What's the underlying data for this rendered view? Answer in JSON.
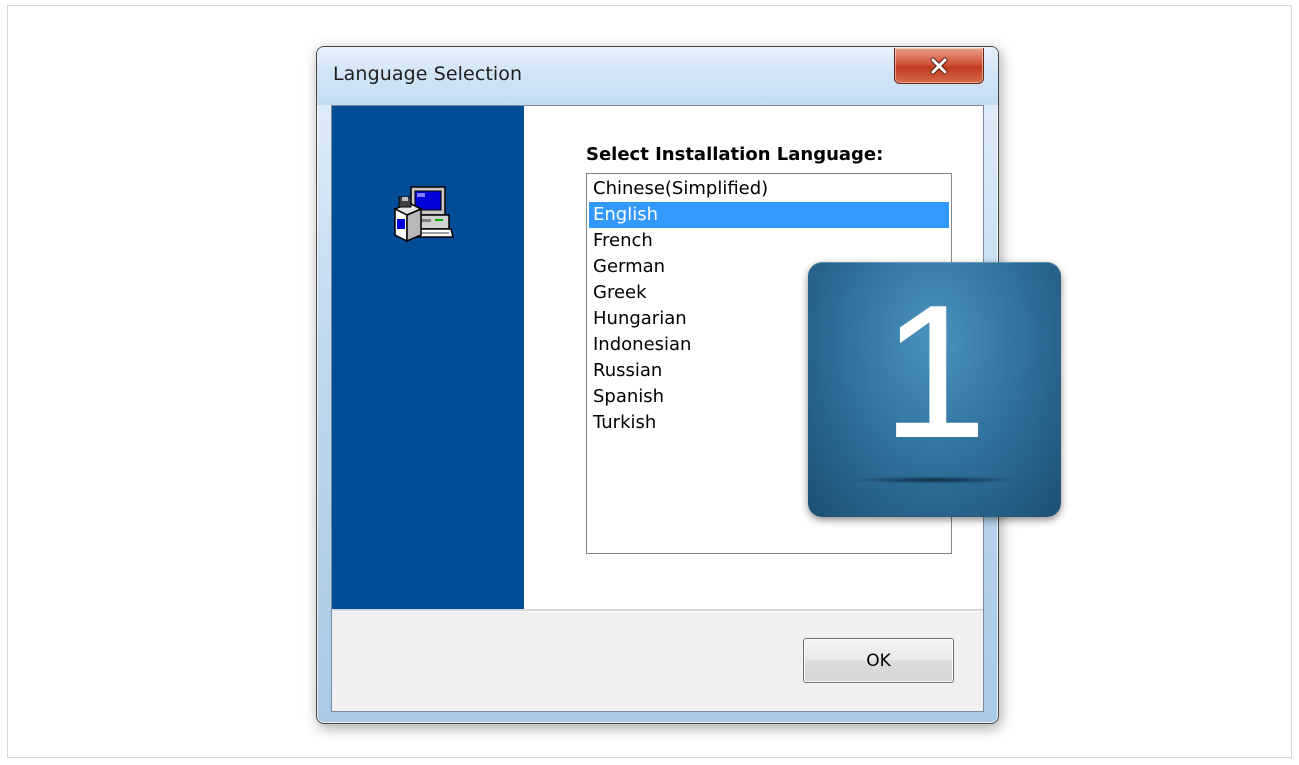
{
  "window": {
    "title": "Language Selection",
    "close_icon": "close-x-icon"
  },
  "sidebar": {
    "icon": "setup-computer-icon",
    "background_color": "#014c97"
  },
  "main": {
    "prompt": "Select Installation Language:",
    "languages": [
      "Chinese(Simplified)",
      "English",
      "French",
      "German",
      "Greek",
      "Hungarian",
      "Indonesian",
      "Russian",
      "Spanish",
      "Turkish"
    ],
    "selected_language": "English",
    "selection_color": "#3399ff"
  },
  "footer": {
    "ok_label": "OK"
  },
  "step_badge": {
    "number": "1"
  }
}
